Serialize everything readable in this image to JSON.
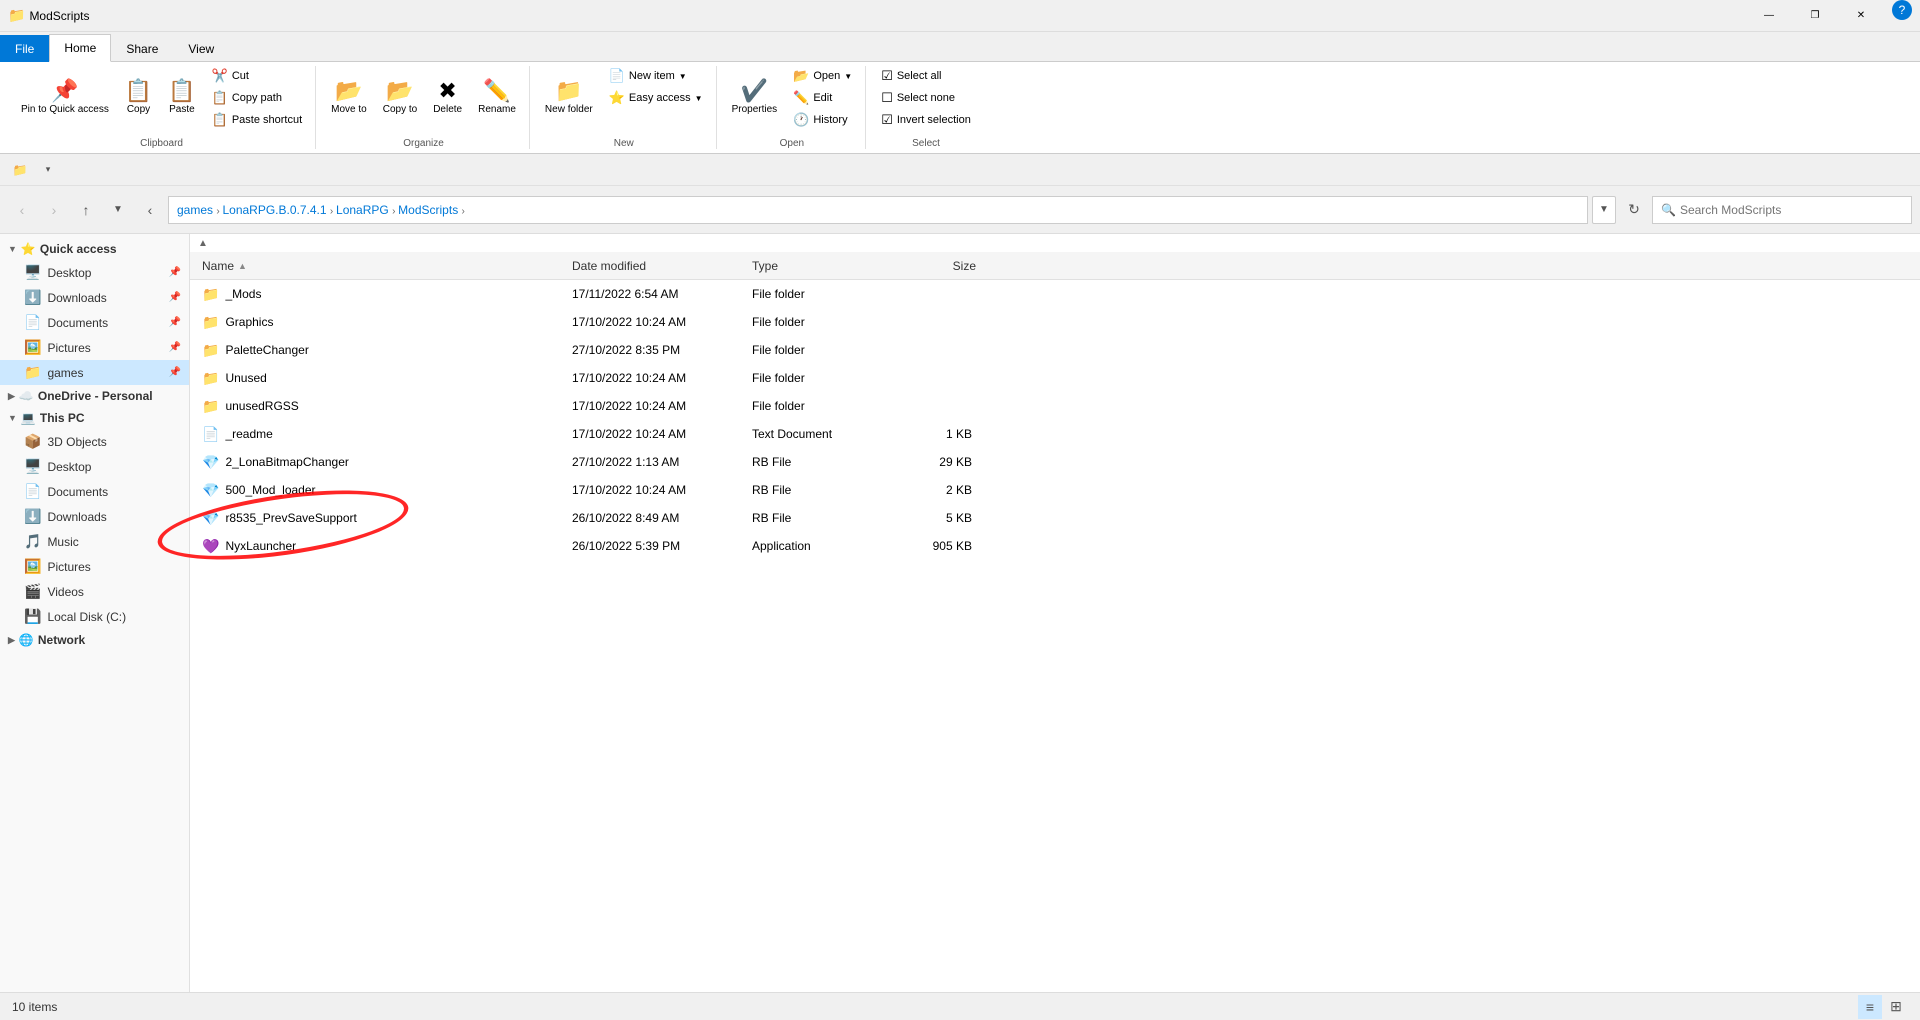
{
  "app": {
    "title": "ModScripts",
    "icon": "📁"
  },
  "titlebar": {
    "minimize": "—",
    "restore": "❐",
    "close": "✕",
    "help": "?"
  },
  "ribbon": {
    "tabs": [
      {
        "id": "file",
        "label": "File",
        "active": false,
        "isFile": true
      },
      {
        "id": "home",
        "label": "Home",
        "active": true
      },
      {
        "id": "share",
        "label": "Share"
      },
      {
        "id": "view",
        "label": "View"
      }
    ],
    "groups": {
      "clipboard": {
        "label": "Clipboard",
        "pin_label": "Pin to Quick access",
        "copy_label": "Copy",
        "paste_label": "Paste",
        "cut_label": "Cut",
        "copypath_label": "Copy path",
        "pasteshortcut_label": "Paste shortcut"
      },
      "organize": {
        "label": "Organize",
        "moveto_label": "Move to",
        "copyto_label": "Copy to",
        "delete_label": "Delete",
        "rename_label": "Rename"
      },
      "new": {
        "label": "New",
        "newitem_label": "New item",
        "easyaccess_label": "Easy access",
        "newfolder_label": "New folder"
      },
      "open": {
        "label": "Open",
        "open_label": "Open",
        "edit_label": "Edit",
        "history_label": "History",
        "properties_label": "Properties"
      },
      "select": {
        "label": "Select",
        "selectall_label": "Select all",
        "selectnone_label": "Select none",
        "invertselection_label": "Invert selection"
      }
    }
  },
  "nav": {
    "back": "‹",
    "forward": "›",
    "up": "↑",
    "recent": "▼",
    "breadcrumbs": [
      {
        "label": "games"
      },
      {
        "label": "LonaRPG.B.0.7.4.1"
      },
      {
        "label": "LonaRPG"
      },
      {
        "label": "ModScripts"
      }
    ],
    "search_placeholder": "Search ModScripts",
    "refresh": "↻"
  },
  "sidebar": {
    "quickaccess_label": "Quick access",
    "quickaccess_items": [
      {
        "label": "Desktop",
        "icon": "🖥️",
        "pinned": true
      },
      {
        "label": "Downloads",
        "icon": "⬇️",
        "pinned": true
      },
      {
        "label": "Documents",
        "icon": "📄",
        "pinned": true
      },
      {
        "label": "Pictures",
        "icon": "🖼️",
        "pinned": true
      },
      {
        "label": "games",
        "icon": "📁",
        "pinned": true,
        "selected": true
      }
    ],
    "onedrive_label": "OneDrive - Personal",
    "thispc_label": "This PC",
    "thispc_items": [
      {
        "label": "3D Objects",
        "icon": "📦"
      },
      {
        "label": "Desktop",
        "icon": "🖥️"
      },
      {
        "label": "Documents",
        "icon": "📄"
      },
      {
        "label": "Downloads",
        "icon": "⬇️"
      },
      {
        "label": "Music",
        "icon": "🎵"
      },
      {
        "label": "Pictures",
        "icon": "🖼️"
      },
      {
        "label": "Videos",
        "icon": "🎬"
      },
      {
        "label": "Local Disk (C:)",
        "icon": "💾"
      }
    ],
    "network_label": "Network",
    "network_icon": "🌐"
  },
  "filelist": {
    "columns": {
      "name": "Name",
      "date": "Date modified",
      "type": "Type",
      "size": "Size"
    },
    "items": [
      {
        "name": "_Mods",
        "date": "17/11/2022 6:54 AM",
        "type": "File folder",
        "size": "",
        "icon": "folder"
      },
      {
        "name": "Graphics",
        "date": "17/10/2022 10:24 AM",
        "type": "File folder",
        "size": "",
        "icon": "folder"
      },
      {
        "name": "PaletteChanger",
        "date": "27/10/2022 8:35 PM",
        "type": "File folder",
        "size": "",
        "icon": "folder"
      },
      {
        "name": "Unused",
        "date": "17/10/2022 10:24 AM",
        "type": "File folder",
        "size": "",
        "icon": "folder"
      },
      {
        "name": "unusedRGSS",
        "date": "17/10/2022 10:24 AM",
        "type": "File folder",
        "size": "",
        "icon": "folder"
      },
      {
        "name": "_readme",
        "date": "17/10/2022 10:24 AM",
        "type": "Text Document",
        "size": "1 KB",
        "icon": "doc"
      },
      {
        "name": "2_LonaBitmapChanger",
        "date": "27/10/2022 1:13 AM",
        "type": "RB File",
        "size": "29 KB",
        "icon": "rb"
      },
      {
        "name": "500_Mod_loader",
        "date": "17/10/2022 10:24 AM",
        "type": "RB File",
        "size": "2 KB",
        "icon": "rb"
      },
      {
        "name": "r8535_PrevSaveSupport",
        "date": "26/10/2022 8:49 AM",
        "type": "RB File",
        "size": "5 KB",
        "icon": "rb"
      },
      {
        "name": "NyxLauncher",
        "date": "26/10/2022 5:39 PM",
        "type": "Application",
        "size": "905 KB",
        "icon": "app"
      }
    ]
  },
  "statusbar": {
    "item_count": "10 items"
  },
  "quickaccess_toolbar": {
    "icon1": "📁",
    "chevron": "▾"
  }
}
